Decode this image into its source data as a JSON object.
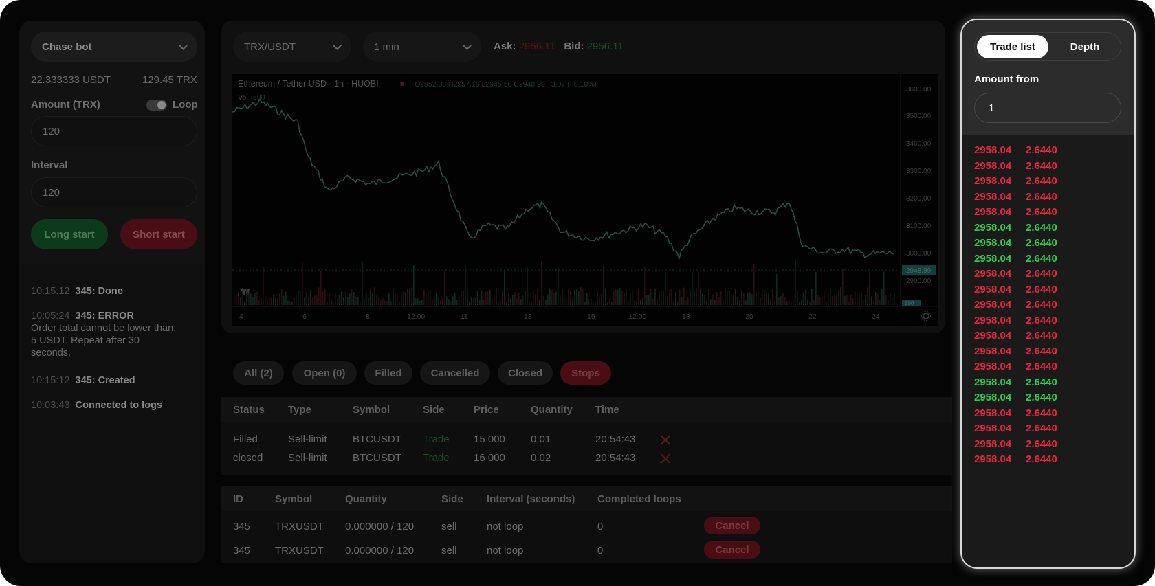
{
  "bot": {
    "selector_label": "Chase bot",
    "balance_usdt": "22.333333 USDT",
    "balance_trx": "129.45 TRX",
    "amount_label": "Amount (TRX)",
    "loop_label": "Loop",
    "amount_value": "120",
    "interval_label": "Interval",
    "interval_value": "120",
    "long_label": "Long start",
    "short_label": "Short start"
  },
  "logs": [
    {
      "time": "10:15:12",
      "text": "345: Done",
      "detail": ""
    },
    {
      "time": "10:05:24",
      "text": "345: ERROR",
      "detail": "Order total cannot be lower than: 5 USDT. Repeat after 30 seconds."
    },
    {
      "time": "10:15:12",
      "text": "345: Created",
      "detail": ""
    },
    {
      "time": "10:03:43",
      "text": "Connected to logs",
      "detail": ""
    }
  ],
  "header": {
    "pair": "TRX/USDT",
    "timeframe": "1 min",
    "ask_label": "Ask:",
    "ask_value": "2956.11",
    "bid_label": "Bid:",
    "bid_value": "2956.11"
  },
  "chart": {
    "title": "Ethereum / Tether USD · 1h · HUOBI",
    "ohlc": "O2952.33 H2957.16 L2945.50 C2948.99 −3.07 (−0.10%)",
    "vol_label": "Vol",
    "vol_value": "590",
    "last_price": "2948.99",
    "last_vol": "590",
    "y_ticks": [
      "3600.00",
      "3500.00",
      "3400.00",
      "3300.00",
      "3200.00",
      "3100.00",
      "3000.00",
      "2900.00"
    ],
    "x_ticks": [
      "4",
      "6",
      "8",
      "12:00",
      "11",
      "13",
      "15",
      "12:00",
      "18",
      "20",
      "22",
      "24"
    ]
  },
  "order_tabs": [
    "All (2)",
    "Open (0)",
    "Filled",
    "Cancelled",
    "Closed",
    "Stops"
  ],
  "orders": {
    "columns": [
      "Status",
      "Type",
      "Symbol",
      "Side",
      "Price",
      "Quantity",
      "Time"
    ],
    "rows": [
      {
        "status": "Filled",
        "type": "Sell-limit",
        "symbol": "BTCUSDT",
        "side": "Trade",
        "price": "15 000",
        "quantity": "0.01",
        "time": "20:54:43"
      },
      {
        "status": "closed",
        "type": "Sell-limit",
        "symbol": "BTCUSDT",
        "side": "Trade",
        "price": "16 000",
        "quantity": "0.02",
        "time": "20:54:43"
      }
    ]
  },
  "bots": {
    "columns": [
      "ID",
      "Symbol",
      "Quantity",
      "Side",
      "Interval (seconds)",
      "Completed loops"
    ],
    "cancel_label": "Cancel",
    "rows": [
      {
        "id": "345",
        "symbol": "TRXUSDT",
        "quantity": "0.000000 / 120",
        "side": "sell",
        "interval": "not loop",
        "loops": "0"
      },
      {
        "id": "345",
        "symbol": "TRXUSDT",
        "quantity": "0.000000 / 120",
        "side": "sell",
        "interval": "not loop",
        "loops": "0"
      }
    ]
  },
  "trade_panel": {
    "tab_active": "Trade list",
    "tab_inactive": "Depth",
    "amount_label": "Amount from",
    "amount_value": "1",
    "colors": {
      "sell": "#e8263c",
      "buy": "#2ecc52"
    },
    "trades": [
      {
        "price": "2958.04",
        "amount": "2.6440",
        "side": "sell"
      },
      {
        "price": "2958.04",
        "amount": "2.6440",
        "side": "sell"
      },
      {
        "price": "2958.04",
        "amount": "2.6440",
        "side": "sell"
      },
      {
        "price": "2958.04",
        "amount": "2.6440",
        "side": "sell"
      },
      {
        "price": "2958.04",
        "amount": "2.6440",
        "side": "sell"
      },
      {
        "price": "2958.04",
        "amount": "2.6440",
        "side": "buy"
      },
      {
        "price": "2958.04",
        "amount": "2.6440",
        "side": "buy"
      },
      {
        "price": "2958.04",
        "amount": "2.6440",
        "side": "buy"
      },
      {
        "price": "2958.04",
        "amount": "2.6440",
        "side": "sell"
      },
      {
        "price": "2958.04",
        "amount": "2.6440",
        "side": "sell"
      },
      {
        "price": "2958.04",
        "amount": "2.6440",
        "side": "sell"
      },
      {
        "price": "2958.04",
        "amount": "2.6440",
        "side": "sell"
      },
      {
        "price": "2958.04",
        "amount": "2.6440",
        "side": "sell"
      },
      {
        "price": "2958.04",
        "amount": "2.6440",
        "side": "sell"
      },
      {
        "price": "2958.04",
        "amount": "2.6440",
        "side": "sell"
      },
      {
        "price": "2958.04",
        "amount": "2.6440",
        "side": "buy"
      },
      {
        "price": "2958.04",
        "amount": "2.6440",
        "side": "buy"
      },
      {
        "price": "2958.04",
        "amount": "2.6440",
        "side": "sell"
      },
      {
        "price": "2958.04",
        "amount": "2.6440",
        "side": "sell"
      },
      {
        "price": "2958.04",
        "amount": "2.6440",
        "side": "sell"
      },
      {
        "price": "2958.04",
        "amount": "2.6440",
        "side": "sell"
      }
    ]
  }
}
